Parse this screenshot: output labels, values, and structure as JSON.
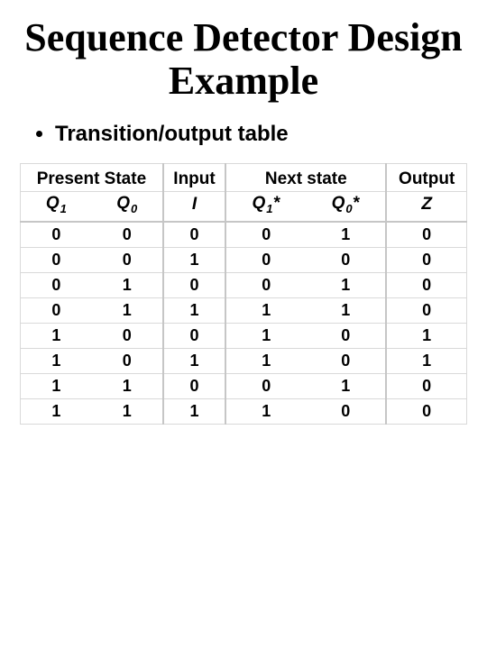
{
  "title": "Sequence Detector Design Example",
  "bullet": "Transition/output table",
  "table": {
    "group_headers": [
      "Present State",
      "Input",
      "Next state",
      "Output"
    ],
    "col_headers": [
      {
        "label": "Q",
        "sub": "1"
      },
      {
        "label": "Q",
        "sub": "0"
      },
      {
        "label": "I",
        "sub": ""
      },
      {
        "label": "Q",
        "sub": "1",
        "suffix": "*"
      },
      {
        "label": "Q",
        "sub": "0",
        "suffix": "*"
      },
      {
        "label": "Z",
        "sub": ""
      }
    ],
    "rows": [
      [
        "0",
        "0",
        "0",
        "0",
        "1",
        "0"
      ],
      [
        "0",
        "0",
        "1",
        "0",
        "0",
        "0"
      ],
      [
        "0",
        "1",
        "0",
        "0",
        "1",
        "0"
      ],
      [
        "0",
        "1",
        "1",
        "1",
        "1",
        "0"
      ],
      [
        "1",
        "0",
        "0",
        "1",
        "0",
        "1"
      ],
      [
        "1",
        "0",
        "1",
        "1",
        "0",
        "1"
      ],
      [
        "1",
        "1",
        "0",
        "0",
        "1",
        "0"
      ],
      [
        "1",
        "1",
        "1",
        "1",
        "0",
        "0"
      ]
    ]
  }
}
